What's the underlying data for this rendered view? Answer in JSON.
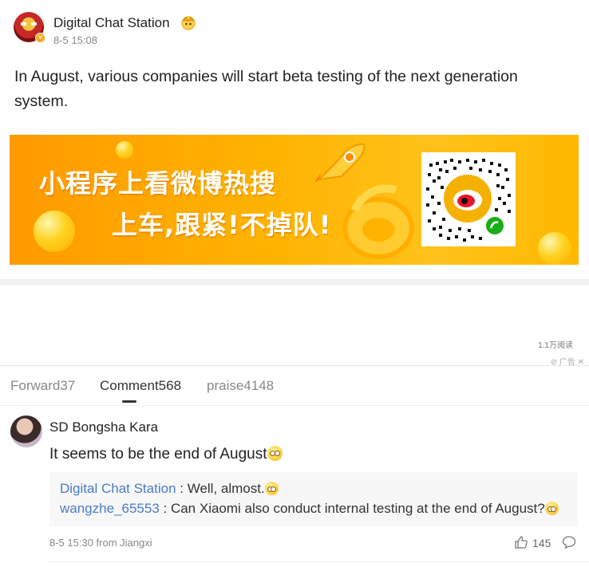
{
  "post": {
    "author": "Digital Chat Station",
    "time": "8-5 15:08",
    "text": "In August, various companies will start beta testing of the next generation system.",
    "verified_color": "#f5a623"
  },
  "banner": {
    "line1": "小程序上看微博热搜",
    "line2": "上车,跟紧!不掉队!",
    "bg_color": "#ffb300"
  },
  "stats": {
    "read_count": "1.1万阅读",
    "ad_label": "广告"
  },
  "tabs": [
    {
      "label": "Forward37",
      "active": false
    },
    {
      "label": "Comment568",
      "active": true
    },
    {
      "label": "praise4148",
      "active": false
    }
  ],
  "comment": {
    "author": "SD Bongsha Kara",
    "text": "It seems to be the end of August",
    "replies": [
      {
        "name": "Digital Chat Station",
        "sep": " : ",
        "text": "Well, almost."
      },
      {
        "name": "wangzhe_65553",
        "sep": " : ",
        "text": "Can Xiaomi also conduct internal testing at the end of August?"
      }
    ],
    "meta": "8-5 15:30 from Jiangxi",
    "likes": "145"
  },
  "colors": {
    "link": "#4a7cc9",
    "accent_orange": "#ff9a00"
  },
  "icons": [
    "crown-icon",
    "verified-icon",
    "rocket-icon",
    "qr-code-icon",
    "like-icon",
    "comment-icon",
    "emoji-icon"
  ]
}
